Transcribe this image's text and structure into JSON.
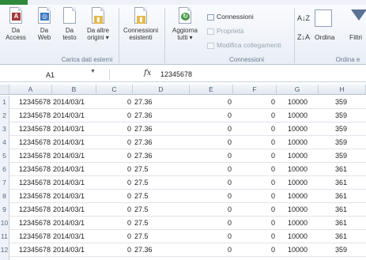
{
  "ribbon": {
    "buttons": [
      {
        "label": "Da\nAccess"
      },
      {
        "label": "Da\nWeb"
      },
      {
        "label": "Da\ntesto"
      },
      {
        "label": "Da altre\norigini ▾"
      },
      {
        "label": "Connessioni\nesistenti"
      },
      {
        "label": "Aggiorna\ntutti ▾"
      }
    ],
    "group_external_label": "Carica dati esterni",
    "connections": {
      "items": [
        {
          "label": "Connessioni",
          "enabled": true
        },
        {
          "label": "Proprietà",
          "enabled": false
        },
        {
          "label": "Modifica collegamenti",
          "enabled": false
        }
      ],
      "group_label": "Connessioni"
    },
    "sort": {
      "az_label": "A↓Z",
      "za_label": "Z↓A",
      "sort_label": "Ordina",
      "filter_label": "Filtri",
      "group_label": "Ordina e"
    }
  },
  "formula_bar": {
    "name_box": "A1",
    "fx": "fx",
    "value": "12345678"
  },
  "columns": [
    "A",
    "B",
    "C",
    "D",
    "E",
    "F",
    "G",
    "H"
  ],
  "rows": [
    {
      "n": "1",
      "a": "12345678",
      "b": "2014/03/1",
      "c": "0",
      "d": "27.36",
      "e": "0",
      "f": "0",
      "g": "10000",
      "h": "359"
    },
    {
      "n": "2",
      "a": "12345678",
      "b": "2014/03/1",
      "c": "0",
      "d": "27.36",
      "e": "0",
      "f": "0",
      "g": "10000",
      "h": "359"
    },
    {
      "n": "3",
      "a": "12345678",
      "b": "2014/03/1",
      "c": "0",
      "d": "27.36",
      "e": "0",
      "f": "0",
      "g": "10000",
      "h": "359"
    },
    {
      "n": "4",
      "a": "12345678",
      "b": "2014/03/1",
      "c": "0",
      "d": "27.36",
      "e": "0",
      "f": "0",
      "g": "10000",
      "h": "359"
    },
    {
      "n": "5",
      "a": "12345678",
      "b": "2014/03/1",
      "c": "0",
      "d": "27.36",
      "e": "0",
      "f": "0",
      "g": "10000",
      "h": "359"
    },
    {
      "n": "6",
      "a": "12345678",
      "b": "2014/03/1",
      "c": "0",
      "d": "27.5",
      "e": "0",
      "f": "0",
      "g": "10000",
      "h": "361"
    },
    {
      "n": "7",
      "a": "12345678",
      "b": "2014/03/1",
      "c": "0",
      "d": "27.5",
      "e": "0",
      "f": "0",
      "g": "10000",
      "h": "361"
    },
    {
      "n": "8",
      "a": "12345678",
      "b": "2014/03/1",
      "c": "0",
      "d": "27.5",
      "e": "0",
      "f": "0",
      "g": "10000",
      "h": "361"
    },
    {
      "n": "9",
      "a": "12345678",
      "b": "2014/03/1",
      "c": "0",
      "d": "27.5",
      "e": "0",
      "f": "0",
      "g": "10000",
      "h": "361"
    },
    {
      "n": "10",
      "a": "12345678",
      "b": "2014/03/1",
      "c": "0",
      "d": "27.5",
      "e": "0",
      "f": "0",
      "g": "10000",
      "h": "361"
    },
    {
      "n": "11",
      "a": "12345678",
      "b": "2014/03/1",
      "c": "0",
      "d": "27.5",
      "e": "0",
      "f": "0",
      "g": "10000",
      "h": "361"
    },
    {
      "n": "12",
      "a": "12345678",
      "b": "2014/03/1",
      "c": "0",
      "d": "27.36",
      "e": "0",
      "f": "0",
      "g": "10000",
      "h": "359"
    },
    {
      "n": "13",
      "a": "12345678",
      "b": "2014/03/1",
      "c": "0",
      "d": "27.36",
      "e": "0",
      "f": "0",
      "g": "10000",
      "h": "359"
    }
  ]
}
